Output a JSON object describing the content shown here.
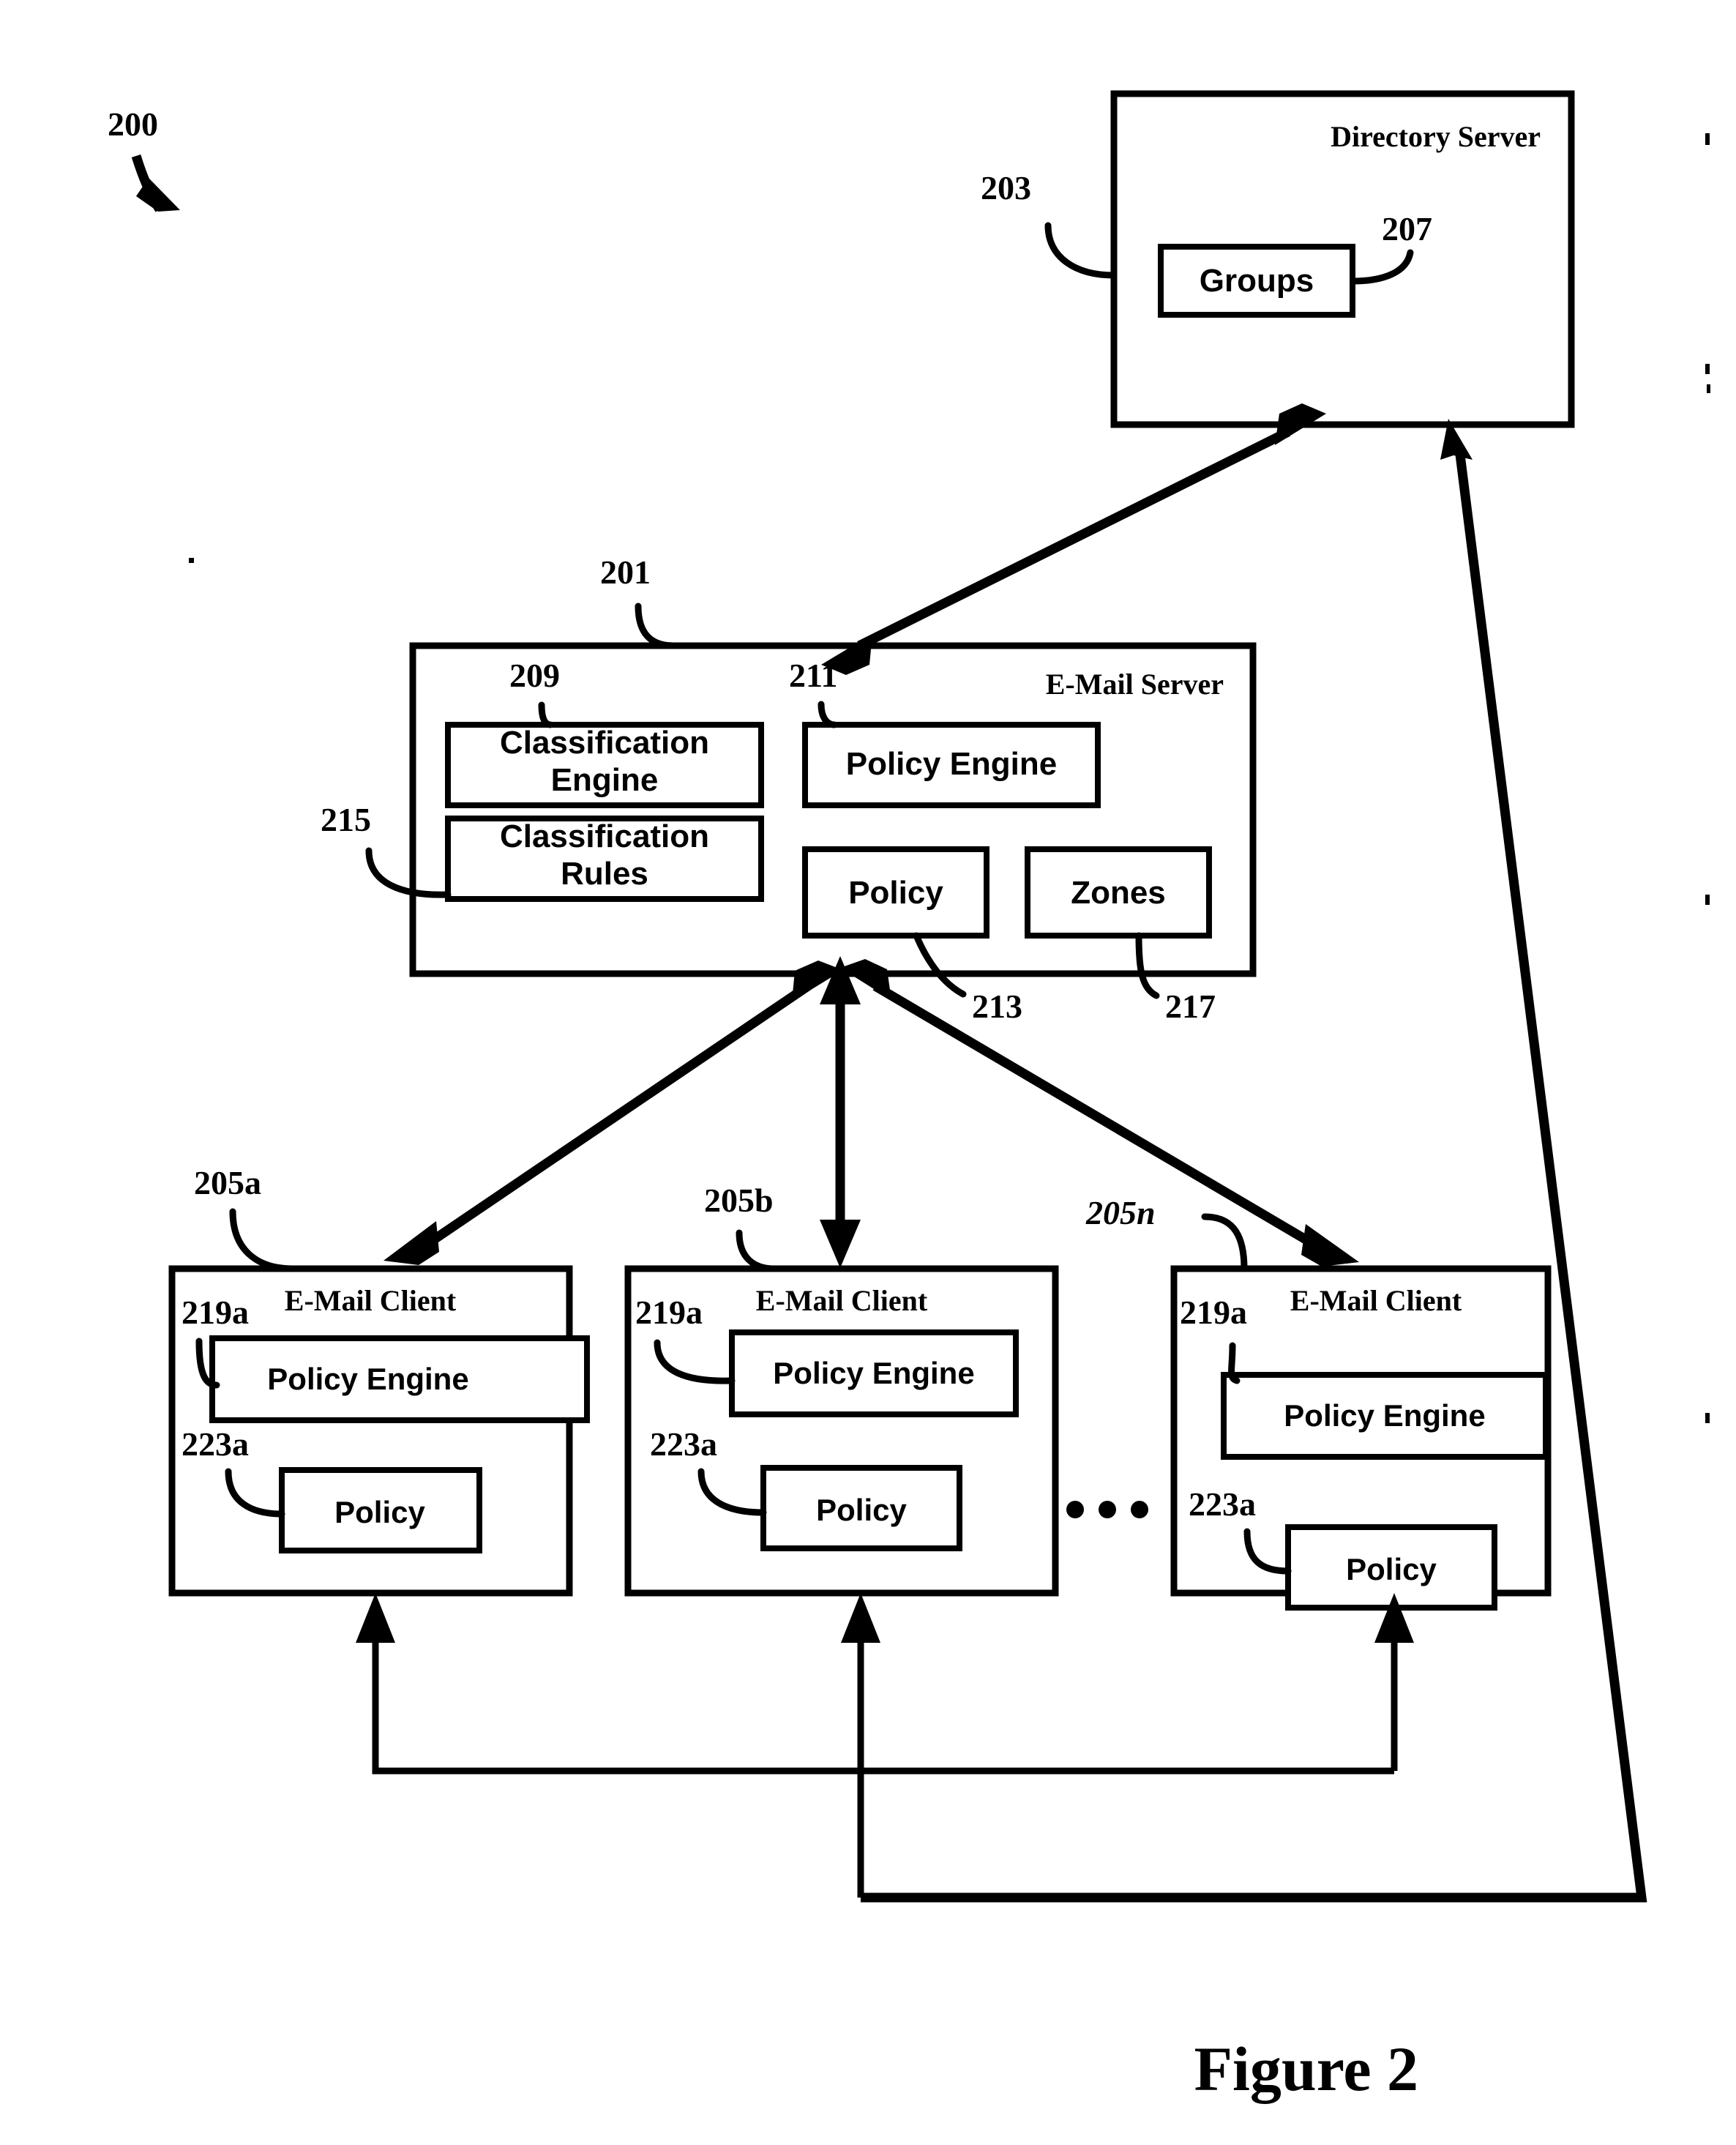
{
  "figure": {
    "caption": "Figure 2",
    "system_ref": "200"
  },
  "directory_server": {
    "title": "Directory Server",
    "ref": "203",
    "groups": {
      "label": "Groups",
      "ref": "207"
    }
  },
  "email_server": {
    "title": "E-Mail Server",
    "ref": "201",
    "components": [
      {
        "label": "Classification Engine",
        "line1": "Classification",
        "line2": "Engine",
        "ref": "209"
      },
      {
        "label": "Classification Rules",
        "line1": "Classification",
        "line2": "Rules",
        "ref": "215"
      },
      {
        "label": "Policy Engine",
        "line1": "Policy Engine",
        "line2": "",
        "ref": "211"
      },
      {
        "label": "Policy",
        "line1": "Policy",
        "line2": "",
        "ref": "213"
      },
      {
        "label": "Zones",
        "line1": "Zones",
        "line2": "",
        "ref": "217"
      }
    ]
  },
  "email_clients": [
    {
      "title": "E-Mail Client",
      "ref": "205a",
      "policy_engine": {
        "label": "Policy Engine",
        "ref": "219a"
      },
      "policy": {
        "label": "Policy",
        "ref": "223a"
      }
    },
    {
      "title": "E-Mail Client",
      "ref": "205b",
      "policy_engine": {
        "label": "Policy Engine",
        "ref": "219a"
      },
      "policy": {
        "label": "Policy",
        "ref": "223a"
      }
    },
    {
      "title": "E-Mail Client",
      "ref": "205n",
      "policy_engine": {
        "label": "Policy Engine",
        "ref": "219a"
      },
      "policy": {
        "label": "Policy",
        "ref": "223a"
      }
    }
  ],
  "ellipsis": "• • •",
  "colors": {
    "ink": "#000000",
    "paper": "#ffffff"
  }
}
